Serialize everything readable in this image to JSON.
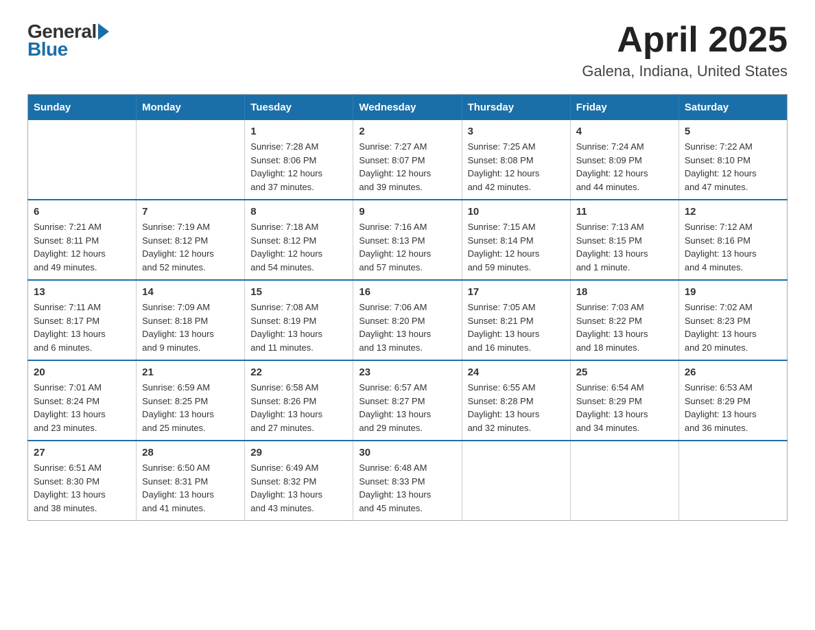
{
  "header": {
    "logo_general": "General",
    "logo_blue": "Blue",
    "month_title": "April 2025",
    "location": "Galena, Indiana, United States"
  },
  "calendar": {
    "days_of_week": [
      "Sunday",
      "Monday",
      "Tuesday",
      "Wednesday",
      "Thursday",
      "Friday",
      "Saturday"
    ],
    "weeks": [
      [
        {
          "day": "",
          "info": ""
        },
        {
          "day": "",
          "info": ""
        },
        {
          "day": "1",
          "info": "Sunrise: 7:28 AM\nSunset: 8:06 PM\nDaylight: 12 hours\nand 37 minutes."
        },
        {
          "day": "2",
          "info": "Sunrise: 7:27 AM\nSunset: 8:07 PM\nDaylight: 12 hours\nand 39 minutes."
        },
        {
          "day": "3",
          "info": "Sunrise: 7:25 AM\nSunset: 8:08 PM\nDaylight: 12 hours\nand 42 minutes."
        },
        {
          "day": "4",
          "info": "Sunrise: 7:24 AM\nSunset: 8:09 PM\nDaylight: 12 hours\nand 44 minutes."
        },
        {
          "day": "5",
          "info": "Sunrise: 7:22 AM\nSunset: 8:10 PM\nDaylight: 12 hours\nand 47 minutes."
        }
      ],
      [
        {
          "day": "6",
          "info": "Sunrise: 7:21 AM\nSunset: 8:11 PM\nDaylight: 12 hours\nand 49 minutes."
        },
        {
          "day": "7",
          "info": "Sunrise: 7:19 AM\nSunset: 8:12 PM\nDaylight: 12 hours\nand 52 minutes."
        },
        {
          "day": "8",
          "info": "Sunrise: 7:18 AM\nSunset: 8:12 PM\nDaylight: 12 hours\nand 54 minutes."
        },
        {
          "day": "9",
          "info": "Sunrise: 7:16 AM\nSunset: 8:13 PM\nDaylight: 12 hours\nand 57 minutes."
        },
        {
          "day": "10",
          "info": "Sunrise: 7:15 AM\nSunset: 8:14 PM\nDaylight: 12 hours\nand 59 minutes."
        },
        {
          "day": "11",
          "info": "Sunrise: 7:13 AM\nSunset: 8:15 PM\nDaylight: 13 hours\nand 1 minute."
        },
        {
          "day": "12",
          "info": "Sunrise: 7:12 AM\nSunset: 8:16 PM\nDaylight: 13 hours\nand 4 minutes."
        }
      ],
      [
        {
          "day": "13",
          "info": "Sunrise: 7:11 AM\nSunset: 8:17 PM\nDaylight: 13 hours\nand 6 minutes."
        },
        {
          "day": "14",
          "info": "Sunrise: 7:09 AM\nSunset: 8:18 PM\nDaylight: 13 hours\nand 9 minutes."
        },
        {
          "day": "15",
          "info": "Sunrise: 7:08 AM\nSunset: 8:19 PM\nDaylight: 13 hours\nand 11 minutes."
        },
        {
          "day": "16",
          "info": "Sunrise: 7:06 AM\nSunset: 8:20 PM\nDaylight: 13 hours\nand 13 minutes."
        },
        {
          "day": "17",
          "info": "Sunrise: 7:05 AM\nSunset: 8:21 PM\nDaylight: 13 hours\nand 16 minutes."
        },
        {
          "day": "18",
          "info": "Sunrise: 7:03 AM\nSunset: 8:22 PM\nDaylight: 13 hours\nand 18 minutes."
        },
        {
          "day": "19",
          "info": "Sunrise: 7:02 AM\nSunset: 8:23 PM\nDaylight: 13 hours\nand 20 minutes."
        }
      ],
      [
        {
          "day": "20",
          "info": "Sunrise: 7:01 AM\nSunset: 8:24 PM\nDaylight: 13 hours\nand 23 minutes."
        },
        {
          "day": "21",
          "info": "Sunrise: 6:59 AM\nSunset: 8:25 PM\nDaylight: 13 hours\nand 25 minutes."
        },
        {
          "day": "22",
          "info": "Sunrise: 6:58 AM\nSunset: 8:26 PM\nDaylight: 13 hours\nand 27 minutes."
        },
        {
          "day": "23",
          "info": "Sunrise: 6:57 AM\nSunset: 8:27 PM\nDaylight: 13 hours\nand 29 minutes."
        },
        {
          "day": "24",
          "info": "Sunrise: 6:55 AM\nSunset: 8:28 PM\nDaylight: 13 hours\nand 32 minutes."
        },
        {
          "day": "25",
          "info": "Sunrise: 6:54 AM\nSunset: 8:29 PM\nDaylight: 13 hours\nand 34 minutes."
        },
        {
          "day": "26",
          "info": "Sunrise: 6:53 AM\nSunset: 8:29 PM\nDaylight: 13 hours\nand 36 minutes."
        }
      ],
      [
        {
          "day": "27",
          "info": "Sunrise: 6:51 AM\nSunset: 8:30 PM\nDaylight: 13 hours\nand 38 minutes."
        },
        {
          "day": "28",
          "info": "Sunrise: 6:50 AM\nSunset: 8:31 PM\nDaylight: 13 hours\nand 41 minutes."
        },
        {
          "day": "29",
          "info": "Sunrise: 6:49 AM\nSunset: 8:32 PM\nDaylight: 13 hours\nand 43 minutes."
        },
        {
          "day": "30",
          "info": "Sunrise: 6:48 AM\nSunset: 8:33 PM\nDaylight: 13 hours\nand 45 minutes."
        },
        {
          "day": "",
          "info": ""
        },
        {
          "day": "",
          "info": ""
        },
        {
          "day": "",
          "info": ""
        }
      ]
    ]
  }
}
